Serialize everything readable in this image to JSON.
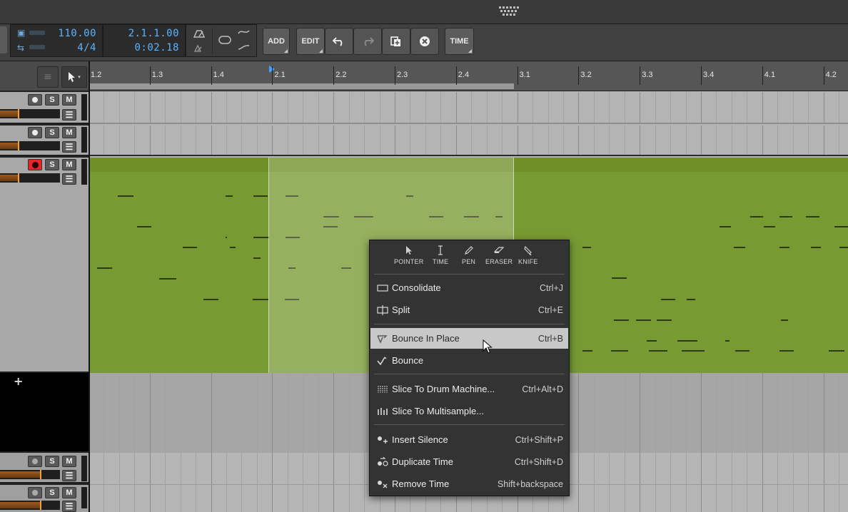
{
  "transport": {
    "tempo": "110.00",
    "time_signature": "4/4",
    "position_beats": "2.1.1.00",
    "position_time": "0:02.18"
  },
  "toolbar": {
    "add_label": "ADD",
    "edit_label": "EDIT",
    "time_label": "TIME",
    "undo_icon": "undo-icon",
    "redo_icon": "redo-icon",
    "duplicate_icon": "duplicate-icon",
    "delete_icon": "delete-icon"
  },
  "ruler": {
    "labels": [
      "1.2",
      "1.3",
      "1.4",
      "2.1",
      "2.2",
      "2.3",
      "2.4",
      "3.1",
      "3.2",
      "3.3",
      "3.4",
      "4.1",
      "4.2"
    ]
  },
  "tracks": [
    {
      "solo": "S",
      "mute": "M",
      "armed": false
    },
    {
      "solo": "S",
      "mute": "M",
      "armed": false
    },
    {
      "solo": "S",
      "mute": "M",
      "armed": true
    },
    {
      "solo": "S",
      "mute": "M",
      "armed": false
    },
    {
      "solo": "S",
      "mute": "M",
      "armed": false
    }
  ],
  "add_track_symbol": "+",
  "context_menu": {
    "tools": [
      {
        "label": "POINTER",
        "icon": "pointer-icon"
      },
      {
        "label": "TIME",
        "icon": "time-select-icon"
      },
      {
        "label": "PEN",
        "icon": "pen-icon"
      },
      {
        "label": "ERASER",
        "icon": "eraser-icon"
      },
      {
        "label": "KNIFE",
        "icon": "knife-icon"
      }
    ],
    "items": [
      {
        "label": "Consolidate",
        "shortcut": "Ctrl+J",
        "icon": "consolidate-icon"
      },
      {
        "label": "Split",
        "shortcut": "Ctrl+E",
        "icon": "split-icon"
      },
      {
        "label": "Bounce In Place",
        "shortcut": "Ctrl+B",
        "icon": "bounce-in-place-icon",
        "highlighted": true
      },
      {
        "label": "Bounce",
        "shortcut": "",
        "icon": "bounce-icon"
      },
      {
        "label": "Slice To Drum Machine...",
        "shortcut": "Ctrl+Alt+D",
        "icon": "slice-drum-icon"
      },
      {
        "label": "Slice To Multisample...",
        "shortcut": "",
        "icon": "slice-multisample-icon"
      },
      {
        "label": "Insert Silence",
        "shortcut": "Ctrl+Shift+P",
        "icon": "insert-silence-icon"
      },
      {
        "label": "Duplicate Time",
        "shortcut": "Ctrl+Shift+D",
        "icon": "duplicate-time-icon"
      },
      {
        "label": "Remove Time",
        "shortcut": "Shift+backspace",
        "icon": "remove-time-icon"
      }
    ]
  },
  "colors": {
    "clip_green": "#789a33",
    "record_armed": "#e4262a",
    "lcd_blue": "#5ab4ff",
    "menu_highlight": "#c8c8c8"
  }
}
